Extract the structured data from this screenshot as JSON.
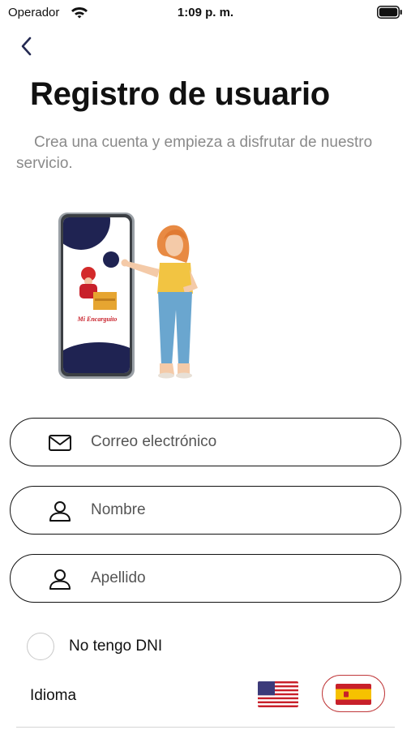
{
  "status": {
    "carrier": "Operador",
    "time": "1:09 p. m."
  },
  "header": {
    "title": "Registro de usuario",
    "subtitle": "Crea una cuenta y empieza a disfrutar de nuestro servicio."
  },
  "illustration": {
    "app_name": "Mi Encarguito"
  },
  "form": {
    "email_placeholder": "Correo electrónico",
    "name_placeholder": "Nombre",
    "lastname_placeholder": "Apellido",
    "no_dni_label": "No tengo DNI",
    "language_label": "Idioma"
  },
  "language": {
    "selected": "es"
  },
  "colors": {
    "accent_navy": "#242a52",
    "selected_border": "#c0393b"
  }
}
